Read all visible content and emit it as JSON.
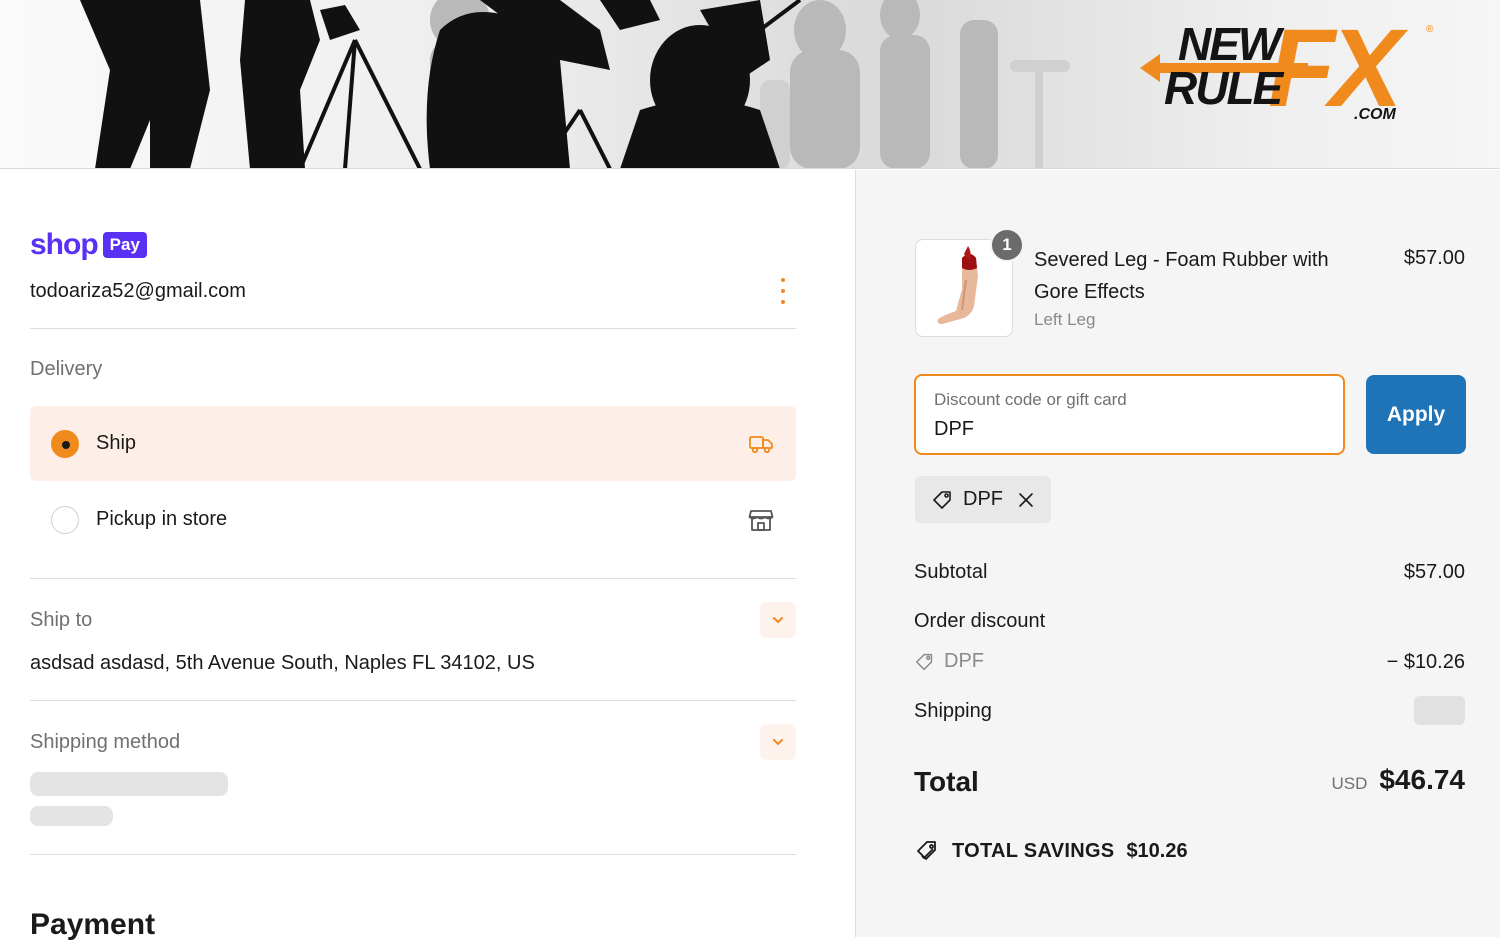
{
  "colors": {
    "accent": "#f08a1c",
    "shop_pay": "#5a31f4",
    "apply_button": "#1f73b7",
    "selected_bg": "#fdefe8"
  },
  "banner": {
    "logo_line1": "NEW",
    "logo_line2": "RULE",
    "logo_fx": "FX",
    "logo_com": ".COM",
    "logo_reg": "®"
  },
  "account": {
    "shop_label": "shop",
    "pay_label": "Pay",
    "email": "todoariza52@gmail.com",
    "menu_icon": "kebab-icon"
  },
  "delivery": {
    "heading": "Delivery",
    "options": [
      {
        "label": "Ship",
        "selected": true,
        "icon": "truck-icon"
      },
      {
        "label": "Pickup in store",
        "selected": false,
        "icon": "store-icon"
      }
    ]
  },
  "ship_to": {
    "heading": "Ship to",
    "address": "asdsad asdasd, 5th Avenue South, Naples FL 34102, US"
  },
  "shipping_method": {
    "heading": "Shipping method"
  },
  "payment": {
    "heading": "Payment"
  },
  "order": {
    "item": {
      "quantity": "1",
      "name": "Severed Leg - Foam Rubber with Gore Effects",
      "variant": "Left Leg",
      "price": "$57.00"
    },
    "discount": {
      "placeholder": "Discount code or gift card",
      "value": "DPF",
      "apply_label": "Apply",
      "applied_code": "DPF"
    },
    "subtotal_label": "Subtotal",
    "subtotal": "$57.00",
    "order_discount_label": "Order discount",
    "discount_code": "DPF",
    "discount_amount": "− $10.26",
    "shipping_label": "Shipping",
    "total_label": "Total",
    "currency": "USD",
    "total": "$46.74",
    "savings_label": "TOTAL SAVINGS",
    "savings": "$10.26"
  }
}
